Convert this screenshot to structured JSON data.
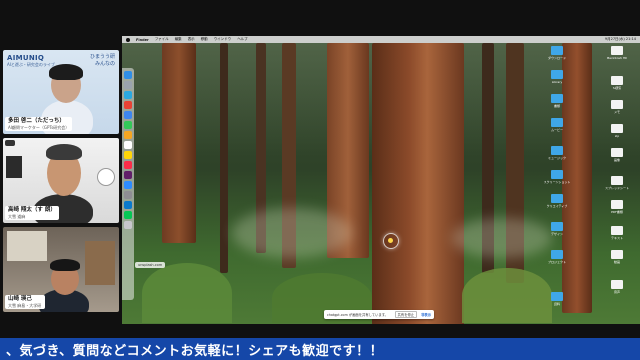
{
  "participants": [
    {
      "name": "多田 啓二（ただっち）",
      "role": "AI顧問マーケター（GPTs研究会）"
    },
    {
      "name": "高崎 翔太（す 朗）",
      "role": "大雪 道麻"
    },
    {
      "name": "山崎 瑛己",
      "role": "大雪 麻島・大学研"
    }
  ],
  "branding": {
    "logo": "AIMUNIQ",
    "tagline": "AIと遊ぶ・研究会のライブ",
    "right_line1": "ひまうう研",
    "right_line2": "みんなの"
  },
  "screen": {
    "menubar": {
      "app": "Finder",
      "items": [
        "ファイル",
        "編集",
        "表示",
        "移動",
        "ウインドウ",
        "ヘルプ"
      ],
      "status": "9月27日(水) 21:14"
    },
    "url_chip": "unsplash.com",
    "share_bar": {
      "message": "chatgpt.com が画面を共有しています。",
      "stop": "共有を停止",
      "hide": "非表示"
    },
    "desktop_icons_left": [
      {
        "label": "ダウンロード",
        "kind": "folder"
      },
      {
        "label": "Library",
        "kind": "folder"
      },
      {
        "label": "書類",
        "kind": "folder"
      },
      {
        "label": "ムービー",
        "kind": "folder"
      },
      {
        "label": "ミュージック",
        "kind": "folder"
      },
      {
        "label": "スクリーンショット",
        "kind": "folder"
      },
      {
        "label": "クリエイティブ",
        "kind": "folder"
      },
      {
        "label": "デザイン",
        "kind": "folder"
      },
      {
        "label": "プロジェクト",
        "kind": "folder"
      },
      {
        "label": "資料",
        "kind": "folder"
      }
    ],
    "desktop_icons_right": [
      {
        "label": "Macintosh HD",
        "kind": "doc"
      },
      {
        "label": "AI研究",
        "kind": "doc"
      },
      {
        "label": "メモ",
        "kind": "doc"
      },
      {
        "label": "zip",
        "kind": "doc"
      },
      {
        "label": "画像",
        "kind": "doc"
      },
      {
        "label": "スプレッドシート",
        "kind": "doc"
      },
      {
        "label": "PDF書類",
        "kind": "doc"
      },
      {
        "label": "テキスト",
        "kind": "doc"
      },
      {
        "label": "動画",
        "kind": "doc"
      },
      {
        "label": "音声",
        "kind": "doc"
      }
    ]
  },
  "ticker": "、気づき、質問などコメントお気軽に！シェアも歓迎です！！"
}
